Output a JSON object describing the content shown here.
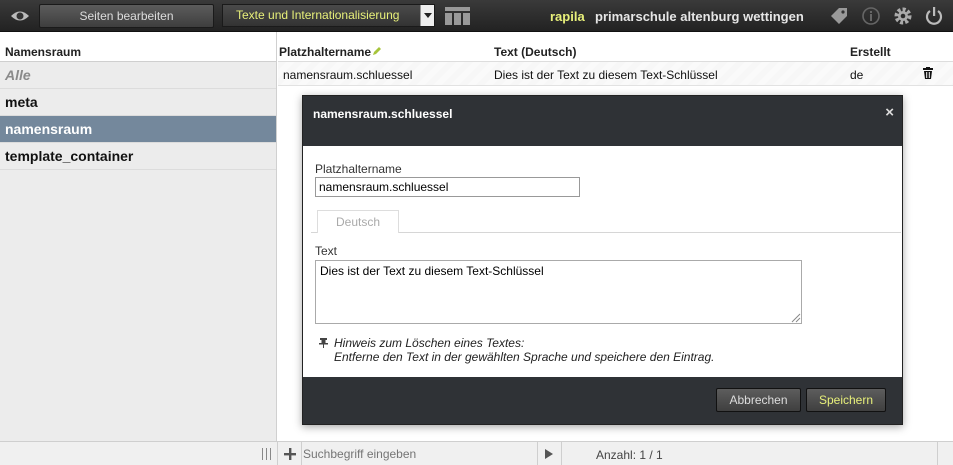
{
  "topbar": {
    "pages_button": "Seiten bearbeiten",
    "module_select": "Texte und Internationalisierung",
    "brand": "rapila",
    "site_name": "primarschule altenburg wettingen",
    "accent_color": "#e8f07a"
  },
  "sidebar": {
    "header": "Namensraum",
    "items": [
      {
        "label": "Alle"
      },
      {
        "label": "meta"
      },
      {
        "label": "namensraum"
      },
      {
        "label": "template_container"
      }
    ]
  },
  "table": {
    "columns": [
      "Platzhaltername",
      "Text (Deutsch)",
      "Erstellt"
    ],
    "rows": [
      {
        "key": "namensraum.schluessel",
        "text": "Dies ist der Text zu diesem Text-Schlüssel",
        "lang": "de"
      }
    ]
  },
  "dialog": {
    "title": "namensraum.schluessel",
    "close": "×",
    "key_label": "Platzhaltername",
    "key_value": "namensraum.schluessel",
    "tab_label": "Deutsch",
    "text_label": "Text",
    "text_value": "Dies ist der Text zu diesem Text-Schlüssel",
    "hint_title": "Hinweis zum Löschen eines Textes:",
    "hint_body": "Entferne den Text in der gewählten Sprache und speichere den Eintrag.",
    "cancel": "Abbrechen",
    "save": "Speichern"
  },
  "bottombar": {
    "search_placeholder": "Suchbegriff eingeben",
    "count": "Anzahl: 1 / 1"
  }
}
